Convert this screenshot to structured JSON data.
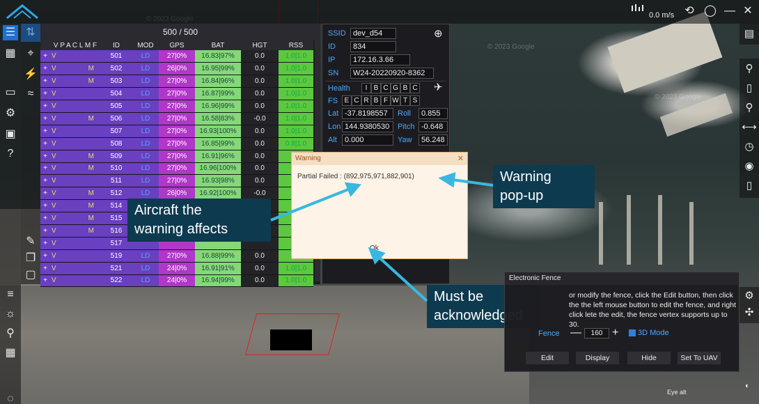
{
  "header": {
    "speed": "0.0 m/s"
  },
  "table": {
    "count": "500 / 500",
    "columns": [
      "",
      "V P A C L M F",
      "ID",
      "MOD",
      "GPS",
      "BAT",
      "HGT",
      "RSS"
    ],
    "rows": [
      {
        "plus": "+",
        "v": "V",
        "m": "",
        "id": "501",
        "mod": "LD",
        "gps": "27|0%",
        "bat": "16.83|97%",
        "hgt": "0.0",
        "rss": "1.0|1.0"
      },
      {
        "plus": "+",
        "v": "V",
        "m": "M",
        "id": "502",
        "mod": "LD",
        "gps": "26|0%",
        "bat": "16.95|99%",
        "hgt": "0.0",
        "rss": "1.0|1.0"
      },
      {
        "plus": "+",
        "v": "V",
        "m": "M",
        "id": "503",
        "mod": "LD",
        "gps": "27|0%",
        "bat": "16.84|96%",
        "hgt": "0.0",
        "rss": "1.0|1.0"
      },
      {
        "plus": "+",
        "v": "V",
        "m": "",
        "id": "504",
        "mod": "LD",
        "gps": "27|0%",
        "bat": "16.87|99%",
        "hgt": "0.0",
        "rss": "1.0|1.0"
      },
      {
        "plus": "+",
        "v": "V",
        "m": "",
        "id": "505",
        "mod": "LD",
        "gps": "27|0%",
        "bat": "16.96|99%",
        "hgt": "0.0",
        "rss": "1.0|1.0"
      },
      {
        "plus": "+",
        "v": "V",
        "m": "M",
        "id": "506",
        "mod": "LD",
        "gps": "27|0%",
        "bat": "16.58|83%",
        "hgt": "-0.0",
        "rss": "1.0|1.0"
      },
      {
        "plus": "+",
        "v": "V",
        "m": "",
        "id": "507",
        "mod": "LD",
        "gps": "27|0%",
        "bat": "16.93|100%",
        "hgt": "0.0",
        "rss": "1.0|1.0"
      },
      {
        "plus": "+",
        "v": "V",
        "m": "",
        "id": "508",
        "mod": "LD",
        "gps": "27|0%",
        "bat": "16.85|99%",
        "hgt": "0.0",
        "rss": "0.8|1.0"
      },
      {
        "plus": "+",
        "v": "V",
        "m": "M",
        "id": "509",
        "mod": "LD",
        "gps": "27|0%",
        "bat": "16.91|96%",
        "hgt": "0.0",
        "rss": ""
      },
      {
        "plus": "+",
        "v": "V",
        "m": "M",
        "id": "510",
        "mod": "LD",
        "gps": "27|0%",
        "bat": "16.96|100%",
        "hgt": "0.0",
        "rss": ""
      },
      {
        "plus": "+",
        "v": "V",
        "m": "",
        "id": "511",
        "mod": "LD",
        "gps": "27|0%",
        "bat": "16.93|98%",
        "hgt": "0.0",
        "rss": ""
      },
      {
        "plus": "+",
        "v": "V",
        "m": "M",
        "id": "512",
        "mod": "LD",
        "gps": "26|0%",
        "bat": "16.92|100%",
        "hgt": "-0.0",
        "rss": ""
      },
      {
        "plus": "+",
        "v": "V",
        "m": "M",
        "id": "514",
        "mod": "",
        "gps": "",
        "bat": "",
        "hgt": "",
        "rss": ""
      },
      {
        "plus": "+",
        "v": "V",
        "m": "M",
        "id": "515",
        "mod": "",
        "gps": "",
        "bat": "",
        "hgt": "",
        "rss": ""
      },
      {
        "plus": "+",
        "v": "V",
        "m": "M",
        "id": "516",
        "mod": "",
        "gps": "",
        "bat": "",
        "hgt": "",
        "rss": ""
      },
      {
        "plus": "+",
        "v": "V",
        "m": "",
        "id": "517",
        "mod": "",
        "gps": "",
        "bat": "",
        "hgt": "",
        "rss": ""
      },
      {
        "plus": "+",
        "v": "V",
        "m": "",
        "id": "519",
        "mod": "LD",
        "gps": "27|0%",
        "bat": "16.88|99%",
        "hgt": "0.0",
        "rss": ""
      },
      {
        "plus": "+",
        "v": "V",
        "m": "",
        "id": "521",
        "mod": "LD",
        "gps": "24|0%",
        "bat": "16.91|91%",
        "hgt": "0.0",
        "rss": "1.0|1.0"
      },
      {
        "plus": "+",
        "v": "V",
        "m": "",
        "id": "522",
        "mod": "LD",
        "gps": "24|0%",
        "bat": "16.94|99%",
        "hgt": "0.0",
        "rss": "1.0|1.0"
      }
    ]
  },
  "info": {
    "ssid_label": "SSID",
    "ssid": "dev_d54",
    "id_label": "ID",
    "id": "834",
    "ip_label": "IP",
    "ip": "172.16.3.66",
    "sn_label": "SN",
    "sn": "W24-20220920-8362",
    "health_label": "Health",
    "health": [
      "I",
      "B",
      "C",
      "G",
      "B",
      "C"
    ],
    "fs_label": "FS",
    "fs": [
      "E",
      "C",
      "R",
      "B",
      "F",
      "W",
      "T",
      "S"
    ],
    "lat_label": "Lat",
    "lat": "-37.8198557",
    "lon_label": "Lon",
    "lon": "144.9380530",
    "alt_label": "Alt",
    "alt": "0.000",
    "roll_label": "Roll",
    "roll": "0.855",
    "pitch_label": "Pitch",
    "pitch": "-0.648",
    "yaw_label": "Yaw",
    "yaw": "56.248"
  },
  "dialog": {
    "title": "Warning",
    "close": "✕",
    "message": "Partial Failed : (892,975,971,882,901)",
    "ok": "Ok"
  },
  "callouts": {
    "popup": "Warning pop-up",
    "popup_l1": "Warning",
    "popup_l2": "pop-up",
    "aircraft_l1": "Aircraft the",
    "aircraft_l2": "warning affects",
    "ack_l1": "Must be",
    "ack_l2": "acknowledged"
  },
  "fence": {
    "title": "Electronic Fence",
    "text": "or modify the fence, click the Edit button, then click the the left mouse button to edit the fence, and right click lete the edit, the fence vertex supports up to 30.",
    "label": "Fence",
    "value": "160",
    "minus": "—",
    "plus": "+",
    "mode3d": "3D Mode",
    "buttons": [
      "Edit",
      "Display",
      "Hide",
      "Set To UAV"
    ]
  },
  "map": {
    "watermark": "© 2023 Google",
    "eye": "Eye alt"
  },
  "colors": {
    "accent": "#1e6fd0",
    "callout_bg": "#0d3a4f",
    "callout_arrow": "#38b8e0"
  }
}
